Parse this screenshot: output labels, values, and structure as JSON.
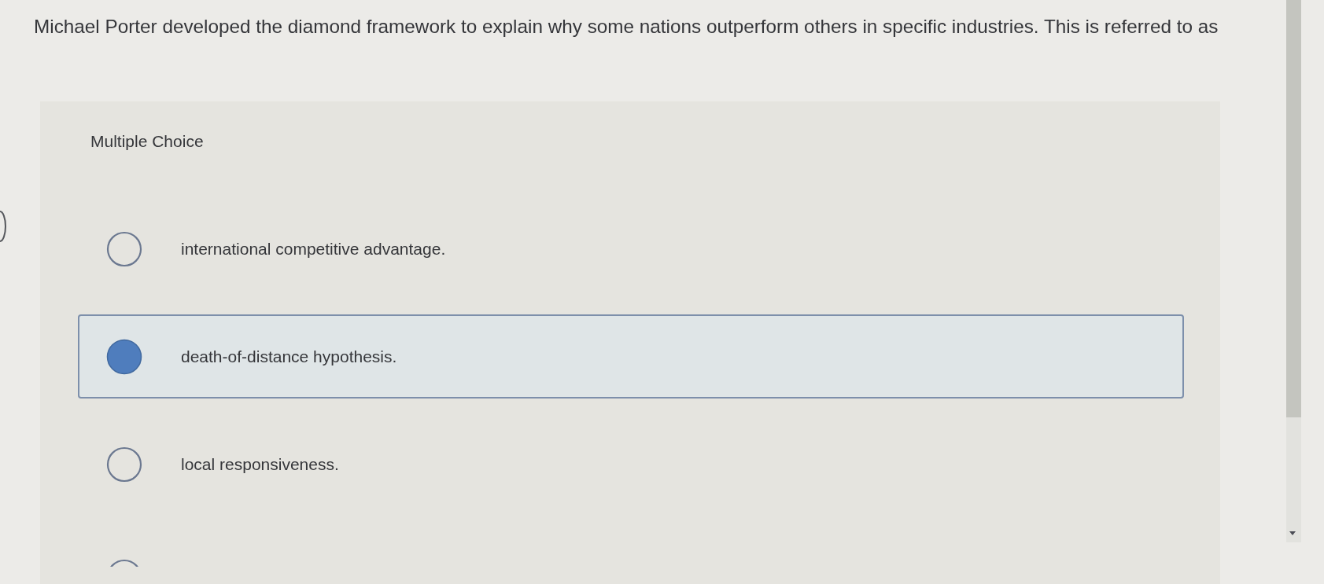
{
  "question": {
    "text": "Michael Porter developed the diamond framework to explain why some nations outperform others in specific industries. This is referred to as"
  },
  "panel": {
    "heading": "Multiple Choice",
    "options": [
      {
        "label": "international competitive advantage.",
        "selected": false
      },
      {
        "label": "death-of-distance hypothesis.",
        "selected": true
      },
      {
        "label": "local responsiveness.",
        "selected": false
      },
      {
        "selected": false
      }
    ]
  }
}
